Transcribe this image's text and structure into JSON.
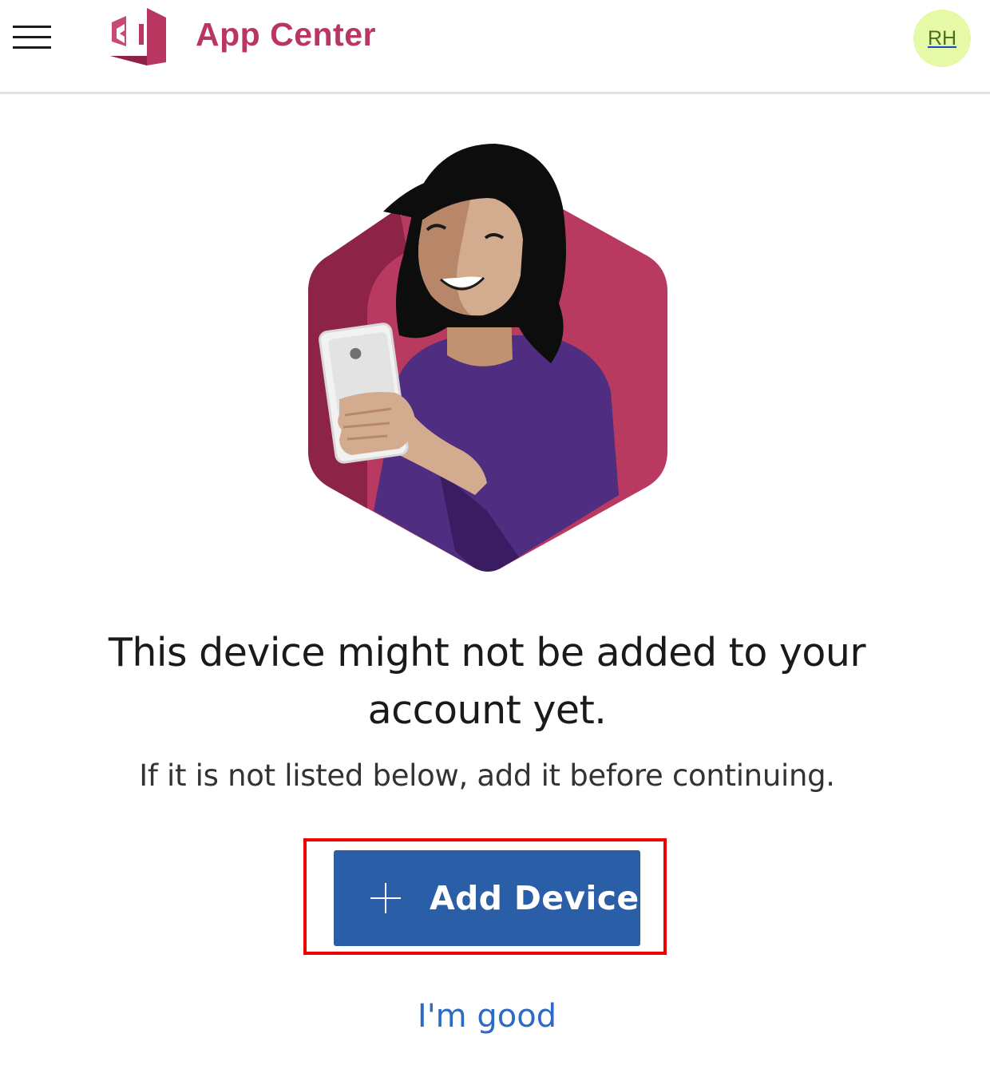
{
  "header": {
    "app_title": "App Center",
    "avatar_initials": "RH",
    "menu_icon": "hamburger-menu-icon",
    "logo_icon": "visual-studio-app-center-logo"
  },
  "main": {
    "illustration": "woman-holding-phone-hexagon-illustration",
    "headline": "This device might not be added to your account yet.",
    "subtext": "If it is not listed below, add it before continuing.",
    "add_device_label": "Add Device",
    "add_device_icon": "plus-icon",
    "im_good_label": "I'm good"
  },
  "colors": {
    "brand": "#b8365f",
    "primary_button": "#2a5fa8",
    "link": "#2c6ac4",
    "highlight_border": "#ec0000",
    "avatar_bg": "#e6f9a7"
  }
}
